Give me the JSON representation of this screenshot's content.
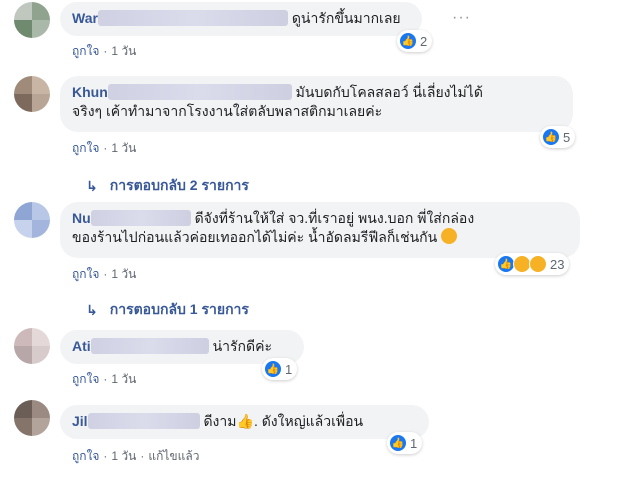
{
  "comments": [
    {
      "author": "War",
      "text": "ดูน่ารักขึ้นมากเลย",
      "like_label": "ถูกใจ",
      "time": "1 วัน",
      "reaction_count": "2",
      "avatar_colors": [
        "#bfc7bf",
        "#8fa38f",
        "#6f8a6f",
        "#a9b8a9"
      ]
    },
    {
      "author": "Khun",
      "text": "มันบดกับโคลสลอว์ นี่เลี่ยงไม่ได้ จริงๆ เค้าทำมาจากโรงงานใส่ตลับพลาสติกมาเลยค่ะ",
      "line1": "มันบดกับโคลสลอว์ นี่เลี่ยงไม่ได้",
      "line2": "จริงๆ เค้าทำมาจากโรงงานใส่ตลับพลาสติกมาเลยค่ะ",
      "like_label": "ถูกใจ",
      "time": "1 วัน",
      "reaction_count": "5",
      "replies": "การตอบกลับ 2 รายการ",
      "avatar_colors": [
        "#a08a7a",
        "#c9b5a4",
        "#7e6a5c",
        "#b8a596"
      ]
    },
    {
      "author": "Nu",
      "line1": "ดีจังที่ร้านให้ใส่ จว.ที่เราอยู่ พนง.บอก พี่ใส่กล่อง",
      "line2": "ของร้านไปก่อนแล้วค่อยเทออกได้ไม่ค่ะ น้ำอัดลมรีฟีลก็เช่นกัน",
      "like_label": "ถูกใจ",
      "time": "1 วัน",
      "reaction_count": "23",
      "replies": "การตอบกลับ 1 รายการ",
      "avatar_colors": [
        "#8fa6d4",
        "#b9c7e6",
        "#c7d2ec",
        "#a3b5dd"
      ]
    },
    {
      "author": "Ati",
      "text": "น่ารักดีค่ะ",
      "like_label": "ถูกใจ",
      "time": "1 วัน",
      "reaction_count": "1",
      "avatar_colors": [
        "#cdb9b9",
        "#e4d8d8",
        "#b7a7a9",
        "#d8cbcc"
      ]
    },
    {
      "author": "Jil",
      "text": "ดีงาม",
      "text_after": ". ดังใหญ่แล้วเพื่อน",
      "like_label": "ถูกใจ",
      "time": "1 วัน",
      "edited": "แก้ไขแล้ว",
      "reaction_count": "1",
      "avatar_colors": [
        "#6b5e57",
        "#9a8a82",
        "#857469",
        "#b3a49b"
      ]
    }
  ],
  "more_icon": "ellipsis-icon",
  "colors": {
    "link": "#385898",
    "bubble": "#f2f3f5",
    "meta": "#606770",
    "like_blue": "#1877f2"
  }
}
